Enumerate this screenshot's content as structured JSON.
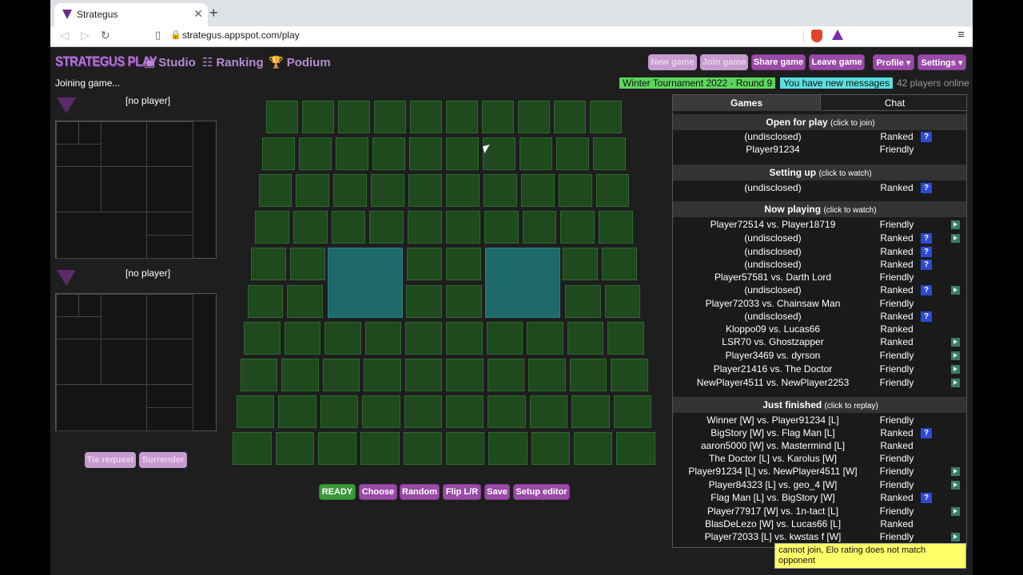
{
  "browser": {
    "tab_title": "Strategus",
    "url": "strategus.appspot.com/play"
  },
  "header": {
    "logo": "STRATEGUS PLAY",
    "nav": [
      {
        "label": "Studio",
        "icon": "studio-icon"
      },
      {
        "label": "Ranking",
        "icon": "list-icon"
      },
      {
        "label": "Podium",
        "icon": "trophy-icon"
      }
    ],
    "buttons": {
      "new_game": "New game",
      "join_game": "Join game",
      "share_game": "Share game",
      "leave_game": "Leave game",
      "profile": "Profile ▾",
      "settings": "Settings ▾"
    }
  },
  "status": {
    "joining": "Joining game...",
    "tournament": "Winter Tournament 2022 - Round 9",
    "messages": "You have new messages",
    "online": "42 players online"
  },
  "players": [
    {
      "name": "[no player]"
    },
    {
      "name": "[no player]"
    }
  ],
  "game_buttons": {
    "tie_request": "Tie request",
    "surrender": "Surrender"
  },
  "action_bar": {
    "ready": "READY",
    "choose": "Choose",
    "random": "Random",
    "flip": "Flip L/R",
    "save": "Save",
    "setup_editor": "Setup editor"
  },
  "panel": {
    "tabs": {
      "games": "Games",
      "chat": "Chat"
    },
    "open_for_play": {
      "title": "Open for play",
      "hint": "(click to join)",
      "rows": [
        {
          "players": "(undisclosed)",
          "type": "Ranked",
          "q": "?",
          "play": false
        },
        {
          "players": "Player91234",
          "type": "Friendly",
          "q": "",
          "play": false
        }
      ]
    },
    "setting_up": {
      "title": "Setting up",
      "hint": "(click to watch)",
      "rows": [
        {
          "players": "(undisclosed)",
          "type": "Ranked",
          "q": "?",
          "play": false
        }
      ]
    },
    "now_playing": {
      "title": "Now playing",
      "hint": "(click to watch)",
      "rows": [
        {
          "players": "Player72514 vs. Player18719",
          "type": "Friendly",
          "q": "",
          "play": true
        },
        {
          "players": "(undisclosed)",
          "type": "Ranked",
          "q": "?",
          "play": true
        },
        {
          "players": "(undisclosed)",
          "type": "Ranked",
          "q": "?",
          "play": false
        },
        {
          "players": "(undisclosed)",
          "type": "Ranked",
          "q": "?",
          "play": false
        },
        {
          "players": "Player57581 vs. Darth Lord",
          "type": "Friendly",
          "q": "",
          "play": false
        },
        {
          "players": "(undisclosed)",
          "type": "Ranked",
          "q": "?",
          "play": true
        },
        {
          "players": "Player72033 vs. Chainsaw Man",
          "type": "Friendly",
          "q": "",
          "play": false
        },
        {
          "players": "(undisclosed)",
          "type": "Ranked",
          "q": "?",
          "play": false
        },
        {
          "players": "Kloppo09 vs. Lucas66",
          "type": "Ranked",
          "q": "",
          "play": false
        },
        {
          "players": "LSR70 vs. Ghostzapper",
          "type": "Ranked",
          "q": "",
          "play": true
        },
        {
          "players": "Player3469 vs. dyrson",
          "type": "Friendly",
          "q": "",
          "play": true
        },
        {
          "players": "Player21416 vs. The Doctor",
          "type": "Friendly",
          "q": "",
          "play": true
        },
        {
          "players": "NewPlayer4511 vs. NewPlayer2253",
          "type": "Friendly",
          "q": "",
          "play": true
        }
      ]
    },
    "just_finished": {
      "title": "Just finished",
      "hint": "(click to replay)",
      "rows": [
        {
          "players": "Winner [W] vs. Player91234 [L]",
          "type": "Friendly",
          "q": "",
          "play": false
        },
        {
          "players": "BigStory [W] vs. Flag Man [L]",
          "type": "Ranked",
          "q": "?",
          "play": false
        },
        {
          "players": "aaron5000 [W] vs. Mastermind [L]",
          "type": "Ranked",
          "q": "",
          "play": false
        },
        {
          "players": "The Doctor [L] vs. Karolus [W]",
          "type": "Friendly",
          "q": "",
          "play": false
        },
        {
          "players": "Player91234 [L] vs. NewPlayer4511 [W]",
          "type": "Friendly",
          "q": "",
          "play": true
        },
        {
          "players": "Player84323 [L] vs. geo_4 [W]",
          "type": "Friendly",
          "q": "",
          "play": true
        },
        {
          "players": "Flag Man [L] vs. BigStory [W]",
          "type": "Ranked",
          "q": "?",
          "play": false
        },
        {
          "players": "Player77917 [W] vs. 1n-tact [L]",
          "type": "Friendly",
          "q": "",
          "play": true
        },
        {
          "players": "BlasDeLezo [W] vs. Lucas66 [L]",
          "type": "Ranked",
          "q": "",
          "play": false
        },
        {
          "players": "Player72033 [L] vs. kwstas f [W]",
          "type": "Friendly",
          "q": "",
          "play": true
        }
      ]
    }
  },
  "tooltip": "cannot join, Elo rating does not match opponent"
}
